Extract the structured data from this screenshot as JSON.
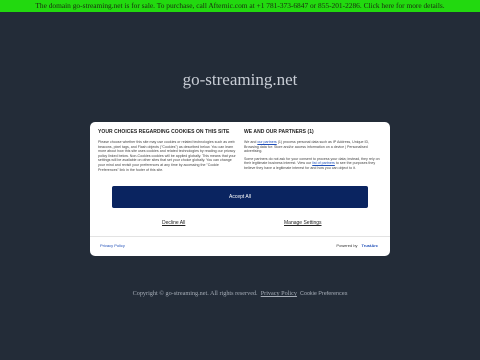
{
  "sale_banner": "The domain go-streaming.net is for sale. To purchase, call Afternic.com at +1 781-373-6847 or 855-201-2286. Click here for more details.",
  "site_title": "go-streaming.net",
  "cookie_modal": {
    "left_heading": "YOUR CHOICES REGARDING COOKIES ON THIS SITE",
    "left_paragraphs": [
      "Please choose whether this site may use cookies or related technologies such as web beacons, pixel tags, and Flash objects (\"Cookies\") as described below. You can learn more about how this site uses cookies and related technologies by reading our privacy policy linked below. Non-Cookies cookies will be applied globally. This means that your settings will be available on other sites that set your choice globally. You can change your mind and revisit your preferences at any time by accessing the \"Cookie Preferences\" link in the footer of this site."
    ],
    "right_heading": "WE AND OUR PARTNERS (1)",
    "right_p1_pre": "We and ",
    "right_p1_link": "our partners",
    "right_p1_post": " (1) process personal data such as IP Address, Unique ID, Browsing data for: Store and/or access information on a device | Personalised advertising.",
    "right_p2_pre": "Some partners do not ask for your consent to process your data; instead, they rely on their legitimate business interest. View our ",
    "right_p2_link": "list of partners",
    "right_p2_post": " to see the purposes they believe they have a legitimate interest for and how you can object to it.",
    "accept_label": "Accept All",
    "decline_label": "Decline All",
    "manage_label": "Manage Settings",
    "privacy_policy_label": "Privacy Policy",
    "powered_by_label": "Powered by",
    "truste_label": "TrustArc"
  },
  "footer": {
    "copyright": "Copyright © go-streaming.net.  All rights reserved.",
    "privacy_policy": "Privacy Policy",
    "cookie_preferences": "Cookie Preferences"
  },
  "colors": {
    "background": "#232c38",
    "banner": "#22d90f",
    "accept_button": "#0a2460",
    "link": "#1f4fb8"
  }
}
